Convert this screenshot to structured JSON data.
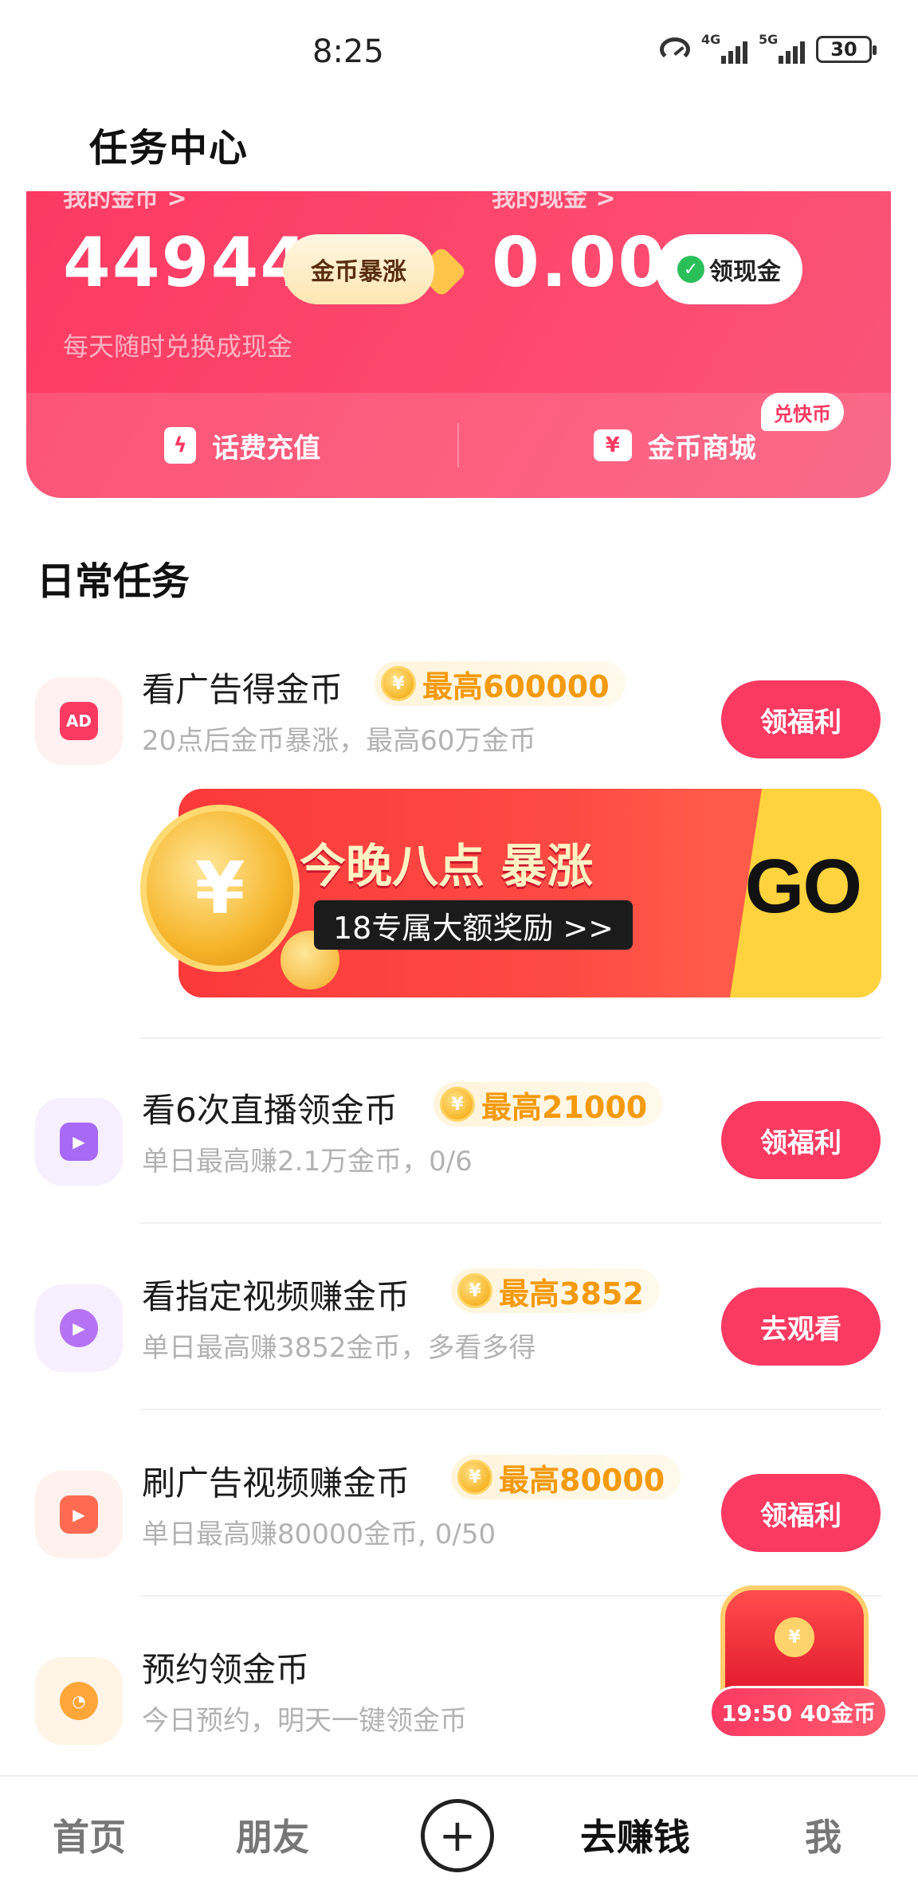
{
  "status": {
    "time": "8:25",
    "net1": "4G",
    "net2": "5G",
    "battery": "30"
  },
  "header": {
    "title": "任务中心"
  },
  "card": {
    "coins_label": "我的金币 >",
    "cash_label": "我的现金 >",
    "coins_value": "44944",
    "surge_label": "金币暴涨",
    "cash_value": "0.00",
    "cash_button": "领现金",
    "subtitle": "每天随时兑换成现金",
    "action_recharge": "话费充值",
    "action_store": "金币商城",
    "store_badge": "兑快币"
  },
  "section": {
    "title": "日常任务"
  },
  "tasks": [
    {
      "title": "看广告得金币",
      "reward": "最高600000",
      "sub": "20点后金币暴涨，最高60万金币",
      "button": "领福利",
      "icon": "ad-icon",
      "icon_label": "AD"
    },
    {
      "title": "看6次直播领金币",
      "reward": "最高21000",
      "sub": "单日最高赚2.1万金币，0/6",
      "button": "领福利",
      "icon": "video-camera-icon"
    },
    {
      "title": "看指定视频赚金币",
      "reward": "最高3852",
      "sub": "单日最高赚3852金币，多看多得",
      "button": "去观看",
      "icon": "play-icon"
    },
    {
      "title": "刷广告视频赚金币",
      "reward": "最高80000",
      "sub": "单日最高赚80000金币, 0/50",
      "button": "领福利",
      "icon": "video-ad-icon"
    },
    {
      "title": "预约领金币",
      "sub": "今日预约，明天一键领金币",
      "icon": "clock-icon"
    }
  ],
  "banner": {
    "title": "今晚八点 暴涨",
    "pill": "18专属大额奖励 >>",
    "go": "GO"
  },
  "chest": {
    "label": "19:50 40金币"
  },
  "nav": {
    "home": "首页",
    "friends": "朋友",
    "earn": "去赚钱",
    "me": "我"
  },
  "colors": {
    "accent": "#fb3a62",
    "reward": "#f39a0f",
    "banner_yellow": "#ffd33d"
  }
}
